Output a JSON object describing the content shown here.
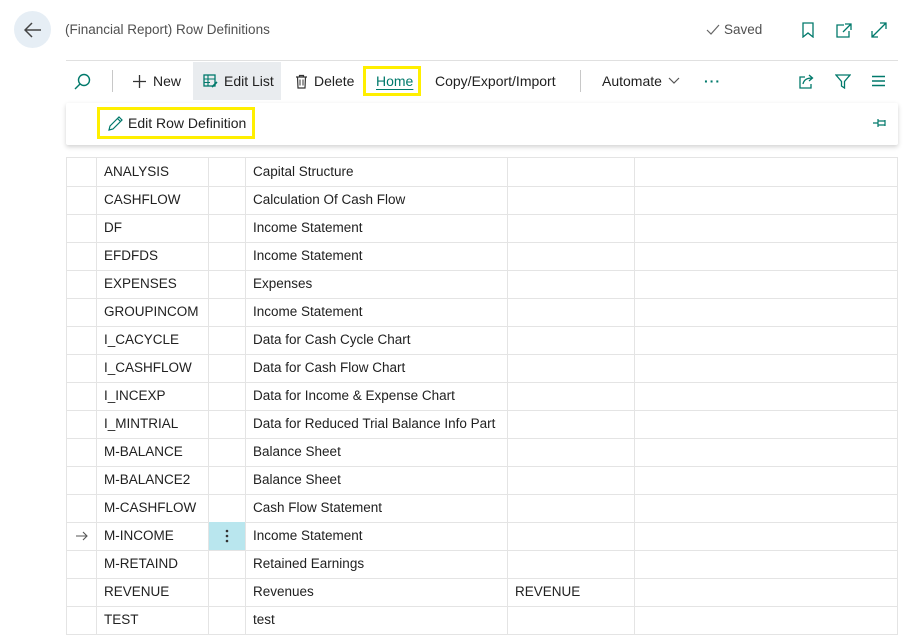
{
  "header": {
    "title": "(Financial Report) Row Definitions",
    "saved_label": "Saved"
  },
  "toolbar": {
    "new_label": "New",
    "edit_list_label": "Edit List",
    "delete_label": "Delete",
    "home_label": "Home",
    "copy_export_import_label": "Copy/Export/Import",
    "automate_label": "Automate",
    "more_label": "···"
  },
  "home_actions": {
    "edit_row_definition_label": "Edit Row Definition"
  },
  "rows": [
    {
      "name": "ANALYSIS",
      "description": "Capital Structure",
      "extra": ""
    },
    {
      "name": "CASHFLOW",
      "description": "Calculation Of Cash Flow",
      "extra": ""
    },
    {
      "name": "DF",
      "description": "Income Statement",
      "extra": ""
    },
    {
      "name": "EFDFDS",
      "description": "Income Statement",
      "extra": ""
    },
    {
      "name": "EXPENSES",
      "description": "Expenses",
      "extra": ""
    },
    {
      "name": "GROUPINCOM",
      "description": "Income Statement",
      "extra": ""
    },
    {
      "name": "I_CACYCLE",
      "description": "Data for Cash Cycle Chart",
      "extra": ""
    },
    {
      "name": "I_CASHFLOW",
      "description": "Data for Cash Flow Chart",
      "extra": ""
    },
    {
      "name": "I_INCEXP",
      "description": "Data for Income & Expense Chart",
      "extra": ""
    },
    {
      "name": "I_MINTRIAL",
      "description": "Data for Reduced Trial Balance Info Part",
      "extra": ""
    },
    {
      "name": "M-BALANCE",
      "description": "Balance Sheet",
      "extra": ""
    },
    {
      "name": "M-BALANCE2",
      "description": "Balance Sheet",
      "extra": ""
    },
    {
      "name": "M-CASHFLOW",
      "description": "Cash Flow Statement",
      "extra": ""
    },
    {
      "name": "M-INCOME",
      "description": "Income Statement",
      "extra": ""
    },
    {
      "name": "M-RETAIND",
      "description": "Retained Earnings",
      "extra": ""
    },
    {
      "name": "REVENUE",
      "description": "Revenues",
      "extra": "REVENUE"
    },
    {
      "name": "TEST",
      "description": "test",
      "extra": ""
    }
  ],
  "selected_row_index": 13,
  "colors": {
    "accent": "#00796b",
    "highlight": "#ffef00",
    "selected_cell": "#b9e6ee"
  }
}
